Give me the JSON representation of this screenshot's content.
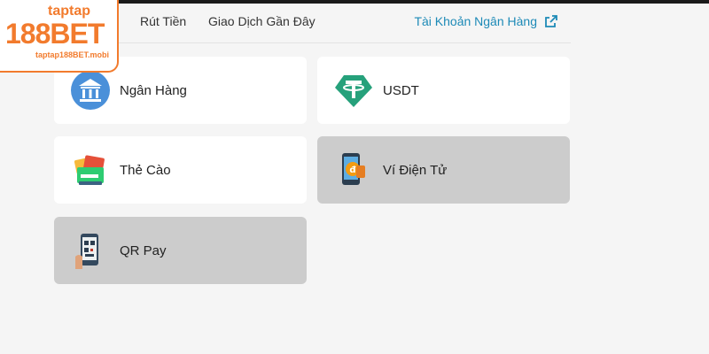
{
  "logo": {
    "top_word": "taptap",
    "brand": "188BET",
    "domain": "taptap188BET.mobi"
  },
  "tabs": {
    "withdraw": "Rút Tiền",
    "recent": "Giao Dịch Gần Đây",
    "bank_account": "Tài Khoản Ngân Hàng"
  },
  "methods": [
    {
      "label": "Ngân Hàng",
      "icon": "bank-icon",
      "enabled": true
    },
    {
      "label": "USDT",
      "icon": "tether-icon",
      "enabled": true
    },
    {
      "label": "Thẻ Cào",
      "icon": "scratch-card-icon",
      "enabled": true
    },
    {
      "label": "Ví Điện Tử",
      "icon": "e-wallet-icon",
      "enabled": false
    },
    {
      "label": "QR Pay",
      "icon": "qr-phone-icon",
      "enabled": false
    }
  ],
  "colors": {
    "accent": "#1d8ab7",
    "brand": "#f27b2d",
    "tether": "#26a17b",
    "bank_icon": "#4a90d9",
    "disabled": "#cccccc"
  }
}
